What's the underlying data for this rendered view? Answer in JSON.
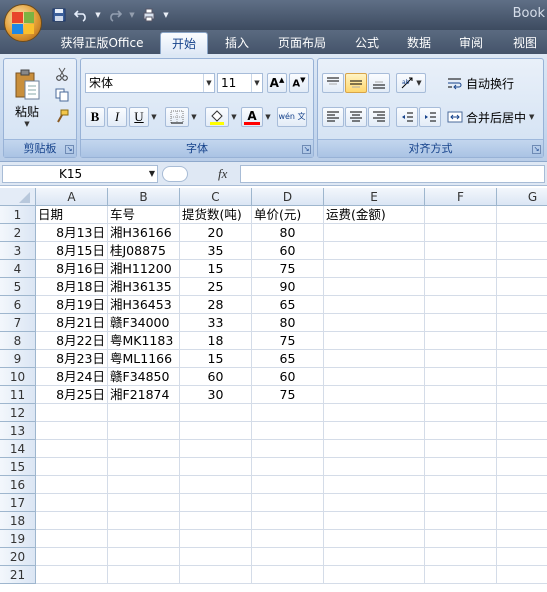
{
  "window": {
    "title_partial": "Book"
  },
  "quick_access": [
    "save-icon",
    "undo-icon",
    "redo-icon",
    "print-preview-icon"
  ],
  "ribbon_tabs": [
    "获得正版Office",
    "开始",
    "插入",
    "页面布局",
    "公式",
    "数据",
    "审阅",
    "视图"
  ],
  "active_tab": "开始",
  "ribbon": {
    "clipboard": {
      "label": "剪贴板",
      "paste_label": "粘贴"
    },
    "font": {
      "label": "字体",
      "font_name": "宋体",
      "font_size": "11",
      "bold": "B",
      "italic": "I",
      "underline": "U",
      "font_color_label": "A",
      "phonetic_label": "wén 文"
    },
    "alignment": {
      "label": "对齐方式",
      "wrap_text": "自动换行",
      "merge_center": "合并后居中"
    }
  },
  "formula_bar": {
    "name_box": "K15",
    "fx_label": "fx",
    "formula": ""
  },
  "sheet": {
    "columns": [
      "A",
      "B",
      "C",
      "D",
      "E",
      "F",
      "G"
    ],
    "row_numbers": [
      "1",
      "2",
      "3",
      "4",
      "5",
      "6",
      "7",
      "8",
      "9",
      "10",
      "11",
      "12",
      "13",
      "14",
      "15",
      "16",
      "17",
      "18",
      "19",
      "20",
      "21"
    ],
    "header_row": [
      "日期",
      "车号",
      "提货数(吨)",
      "单价(元)",
      "运费(金额)"
    ],
    "rows": [
      [
        "8月13日",
        "湘H36166",
        "20",
        "80"
      ],
      [
        "8月15日",
        "桂J08875",
        "35",
        "60"
      ],
      [
        "8月16日",
        "湘H11200",
        "15",
        "75"
      ],
      [
        "8月18日",
        "湘H36135",
        "25",
        "90"
      ],
      [
        "8月19日",
        "湘H36453",
        "28",
        "65"
      ],
      [
        "8月21日",
        "赣F34000",
        "33",
        "80"
      ],
      [
        "8月22日",
        "粤MK1183",
        "18",
        "75"
      ],
      [
        "8月23日",
        "粤ML1166",
        "15",
        "65"
      ],
      [
        "8月24日",
        "赣F34850",
        "60",
        "60"
      ],
      [
        "8月25日",
        "湘F21874",
        "30",
        "75"
      ]
    ]
  }
}
